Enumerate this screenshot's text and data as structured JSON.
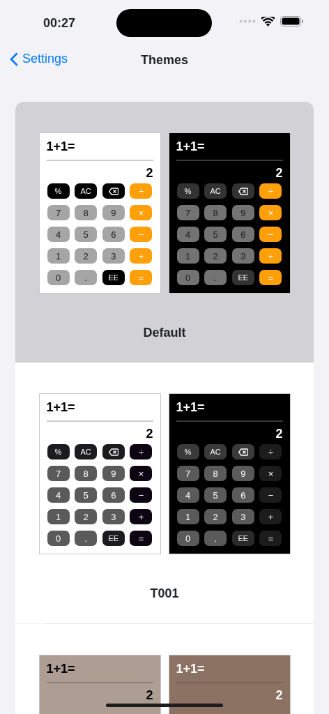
{
  "status_bar": {
    "time": "00:27"
  },
  "nav": {
    "back": "Settings",
    "title": "Themes"
  },
  "themes": [
    {
      "name": "Default",
      "selected": true,
      "kind": "orange",
      "previews": [
        {
          "kind": "light",
          "expression": "1+1=",
          "result": "2",
          "keys": [
            [
              "%",
              "AC",
              {
                "kind": "backspace"
              },
              "÷"
            ],
            [
              "7",
              "8",
              "9",
              "×"
            ],
            [
              "4",
              "5",
              "6",
              "−"
            ],
            [
              "1",
              "2",
              "3",
              "+"
            ],
            [
              "0",
              ".",
              "EE",
              "="
            ]
          ]
        },
        {
          "kind": "dark",
          "expression": "1+1=",
          "result": "2",
          "keys": [
            [
              "%",
              "AC",
              {
                "kind": "backspace"
              },
              "÷"
            ],
            [
              "7",
              "8",
              "9",
              "×"
            ],
            [
              "4",
              "5",
              "6",
              "−"
            ],
            [
              "1",
              "2",
              "3",
              "+"
            ],
            [
              "0",
              ".",
              "EE",
              "="
            ]
          ]
        }
      ]
    },
    {
      "name": "T001",
      "selected": false,
      "kind": "mono",
      "previews": [
        {
          "kind": "light",
          "expression": "1+1=",
          "result": "2",
          "keys": [
            [
              "%",
              "AC",
              {
                "kind": "backspace"
              },
              "÷"
            ],
            [
              "7",
              "8",
              "9",
              "×"
            ],
            [
              "4",
              "5",
              "6",
              "−"
            ],
            [
              "1",
              "2",
              "3",
              "+"
            ],
            [
              "0",
              ".",
              "EE",
              "="
            ]
          ]
        },
        {
          "kind": "dark",
          "expression": "1+1=",
          "result": "2",
          "keys": [
            [
              "%",
              "AC",
              {
                "kind": "backspace"
              },
              "÷"
            ],
            [
              "7",
              "8",
              "9",
              "×"
            ],
            [
              "4",
              "5",
              "6",
              "−"
            ],
            [
              "1",
              "2",
              "3",
              "+"
            ],
            [
              "0",
              ".",
              "EE",
              "="
            ]
          ]
        }
      ]
    },
    {
      "kind": "brown",
      "previews": [
        {
          "kind": "light",
          "expression": "1+1=",
          "result": "2"
        },
        {
          "kind": "dark",
          "expression": "1+1=",
          "result": "2"
        }
      ]
    }
  ]
}
